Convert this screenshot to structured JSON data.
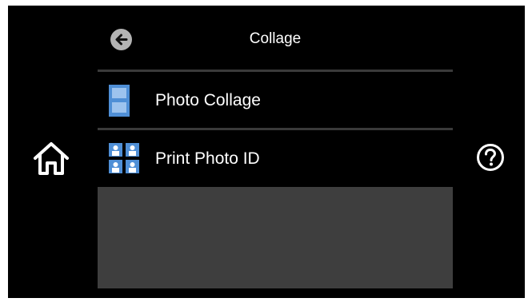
{
  "header": {
    "title": "Collage"
  },
  "menu": {
    "items": [
      {
        "label": "Photo Collage",
        "icon": "photo-collage-icon"
      },
      {
        "label": "Print Photo ID",
        "icon": "photo-id-icon"
      }
    ]
  },
  "icons": {
    "back": "back-arrow-icon",
    "home": "home-icon",
    "help": "help-icon"
  },
  "colors": {
    "background": "#000000",
    "accent_icon_blue": "#4f8fd6",
    "panel_gray": "#3e3e3e",
    "divider_gray": "#3a3a3a"
  }
}
